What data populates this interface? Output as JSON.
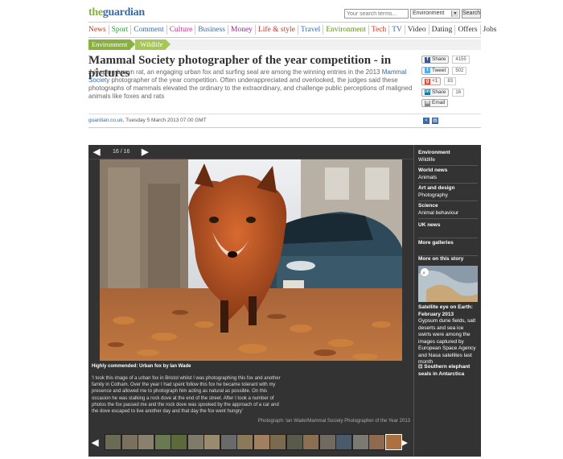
{
  "site": {
    "logo_the": "the",
    "logo_name": "guardian"
  },
  "search": {
    "placeholder": "Your search terms...",
    "section": "Environment",
    "button": "Search"
  },
  "nav": [
    {
      "label": "News",
      "color": "#c0392b"
    },
    {
      "label": "Sport",
      "color": "#27a33a"
    },
    {
      "label": "Comment",
      "color": "#3a6aa3"
    },
    {
      "label": "Culture",
      "color": "#c0308a"
    },
    {
      "label": "Business",
      "color": "#3a6aa3"
    },
    {
      "label": "Money",
      "color": "#8b2c8b"
    },
    {
      "label": "Life & style",
      "color": "#c0392b"
    },
    {
      "label": "Travel",
      "color": "#3a6aa3"
    },
    {
      "label": "Environment",
      "color": "#5c8a1f"
    },
    {
      "label": "Tech",
      "color": "#c0392b"
    },
    {
      "label": "TV",
      "color": "#3a6aa3"
    },
    {
      "label": "Video",
      "color": "#333333"
    },
    {
      "label": "Dating",
      "color": "#333333"
    },
    {
      "label": "Offers",
      "color": "#333333"
    },
    {
      "label": "Jobs",
      "color": "#333333"
    }
  ],
  "breadcrumb": [
    "Environment",
    "Wildlife"
  ],
  "article": {
    "headline": "Mammal Society photographer of the year competition - in pictures",
    "standfirst_a": "A leaping brown rat, an engaging urban fox and surfing seal are among the winning entries in the 2013 ",
    "standfirst_link": "Mammal Society",
    "standfirst_b": " photographer of the year competition. Often underappreciated and overlooked, the judges said these photographs of mammals elevated the ordinary to the extraordinary, and challenge public perceptions of maligned animals like foxes and rats",
    "byline_source": "guardian.co.uk",
    "byline_date": ", Tuesday 5 March 2013 07.00 GMT"
  },
  "share": {
    "facebook": {
      "label": "Share",
      "count": "4155"
    },
    "twitter": {
      "label": "Tweet",
      "count": "502"
    },
    "gplus": {
      "label": "+1",
      "count": "83"
    },
    "linkedin": {
      "label": "Share",
      "count": "16"
    },
    "email": {
      "label": "Email"
    }
  },
  "gallery": {
    "counter": "16 / 16",
    "caption_title": "Highly commended: Urban fox by Ian Wade",
    "caption_text": "'I took this image of a urban fox in Bristol whilst I was photographing this fox and another family in Cotham. Over the year I had spent follow this fox he became tolerant with my presence and allowed me to photograph him acting as natural as possible. On this occasion he was stalking a rock dove at the end of the street. After I took a number of photos the fox passed me and the rock dove was spooked by the approach of a car and the dove escaped to live another day and that day the fox went hungry'",
    "credit": "Photograph: Ian Wade/Mammal Society Photographer of the Year 2013",
    "thumb_colors": [
      "#6b6a55",
      "#7a7060",
      "#8a8070",
      "#6a7a50",
      "#5a6a3a",
      "#807a6a",
      "#9a8a70",
      "#6a6a6a",
      "#8a7a5a",
      "#a08060",
      "#7a6a50",
      "#5a5a4a",
      "#8a7050",
      "#706a60",
      "#4a5a6a",
      "#7a7a70",
      "#906a50",
      "#aa7040"
    ]
  },
  "sidebar": {
    "sections": [
      {
        "title": "Environment",
        "sub": "Wildlife"
      },
      {
        "title": "World news",
        "sub": "Animals"
      },
      {
        "title": "Art and design",
        "sub": "Photography"
      },
      {
        "title": "Science",
        "sub": "Animal behaviour"
      },
      {
        "title": "UK news",
        "sub": ""
      },
      {
        "title": "More galleries",
        "sub": ""
      }
    ],
    "more_heading": "More on this story",
    "story1_title": "Satellite eye on Earth: February 2013",
    "story1_text": "Gypsum dune fields, salt deserts and sea ice swirls were among the images captured by European Space Agency and Nasa satellites last month",
    "story2_title": "Southern elephant seals in Antarctica"
  }
}
